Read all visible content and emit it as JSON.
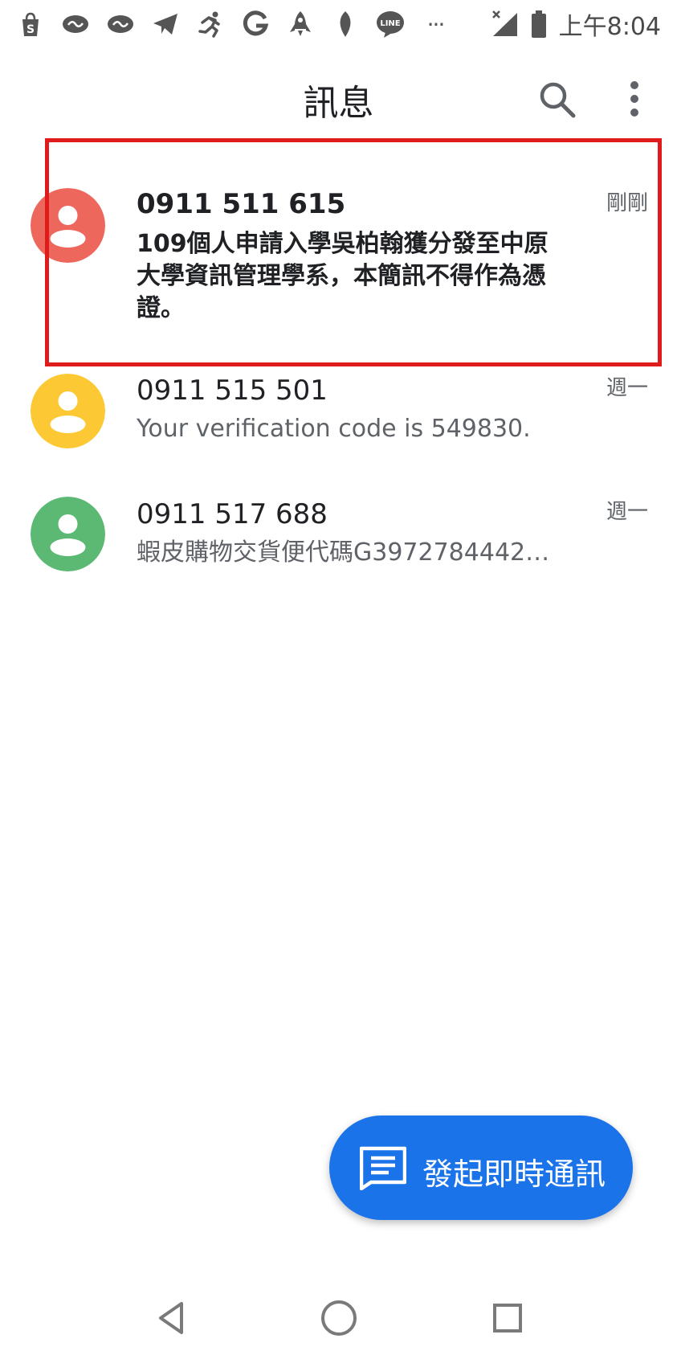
{
  "status_bar": {
    "icons": [
      "shopee-icon",
      "chat-bubble-icon",
      "chat-bubble-icon",
      "telegram-icon",
      "running-icon",
      "google-icon",
      "rocket-icon",
      "leaf-icon",
      "line-icon",
      "more-icon",
      "signal-icon",
      "battery-icon"
    ],
    "more_text": "···",
    "time": "上午8:04"
  },
  "app_bar": {
    "title": "訊息"
  },
  "conversations": [
    {
      "name": "0911 511 615",
      "snippet": "109個人申請入學吳柏翰獲分發至中原大學資訊管理學系，本簡訊不得作為憑證。",
      "time": "剛剛",
      "avatar_color": "#ee675c",
      "unread": true
    },
    {
      "name": "0911 515 501",
      "snippet": "Your verification code is 549830.",
      "time": "週一",
      "avatar_color": "#fcc934",
      "unread": false
    },
    {
      "name": "0911 517 688",
      "snippet": "蝦皮購物交貨便代碼G3972784442…",
      "time": "週一",
      "avatar_color": "#5bb974",
      "unread": false
    }
  ],
  "fab": {
    "label": "發起即時通訊"
  },
  "colors": {
    "accent": "#1a73e8",
    "highlight": "#e01b1b"
  }
}
